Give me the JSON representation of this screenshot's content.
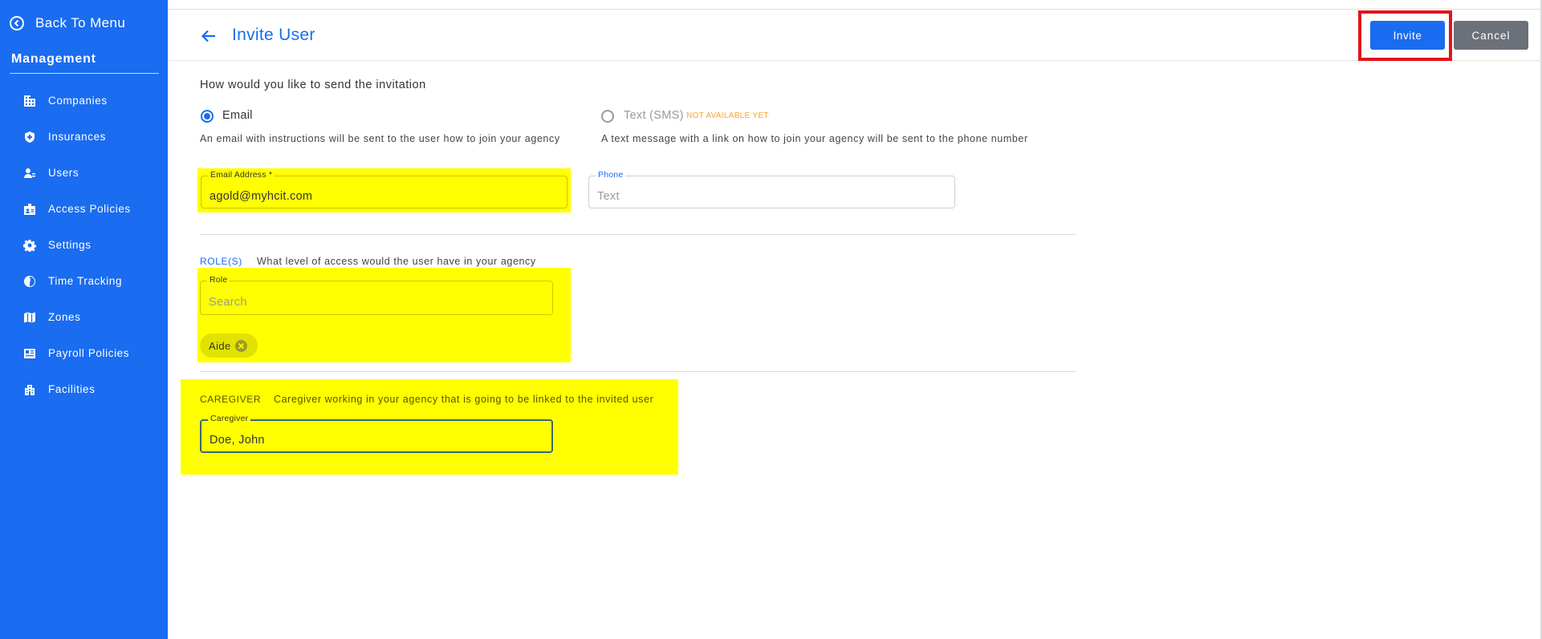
{
  "sidebar": {
    "back_label": "Back To Menu",
    "section_title": "Management",
    "items": [
      {
        "label": "Companies",
        "icon": "building-icon"
      },
      {
        "label": "Insurances",
        "icon": "shield-icon"
      },
      {
        "label": "Users",
        "icon": "users-icon"
      },
      {
        "label": "Access Policies",
        "icon": "badge-icon"
      },
      {
        "label": "Settings",
        "icon": "gear-icon"
      },
      {
        "label": "Time Tracking",
        "icon": "clock-icon"
      },
      {
        "label": "Zones",
        "icon": "map-icon"
      },
      {
        "label": "Payroll Policies",
        "icon": "id-card-icon"
      },
      {
        "label": "Facilities",
        "icon": "facility-icon"
      }
    ]
  },
  "header": {
    "title": "Invite User",
    "invite_label": "Invite",
    "cancel_label": "Cancel"
  },
  "invitation": {
    "question": "How would you like to send the invitation",
    "email_option": "Email",
    "sms_option": "Text (SMS)",
    "sms_badge": "NOT AVAILABLE YET",
    "email_hint": "An email with instructions will be sent to the user how to join your agency",
    "sms_hint": "A text message with a link on how to join your agency will be sent to the phone number",
    "selected": "Email"
  },
  "fields": {
    "email_label": "Email Address *",
    "email_value": "agold@myhcit.com",
    "phone_label": "Phone",
    "phone_placeholder": "Text"
  },
  "roles": {
    "title": "ROLE(S)",
    "description": "What level of access would the user have in your agency",
    "role_label": "Role",
    "role_placeholder": "Search",
    "chips": [
      "Aide"
    ]
  },
  "caregiver": {
    "title": "CAREGIVER",
    "description": "Caregiver working in your agency that is going to be linked to the invited user",
    "field_label": "Caregiver",
    "value": "Doe, John"
  },
  "colors": {
    "primary": "#1a6cf0",
    "highlight": "#ffff00",
    "annotation_red": "#e0141e",
    "cancel_gray": "#6b7079",
    "warning": "#f5a623"
  }
}
